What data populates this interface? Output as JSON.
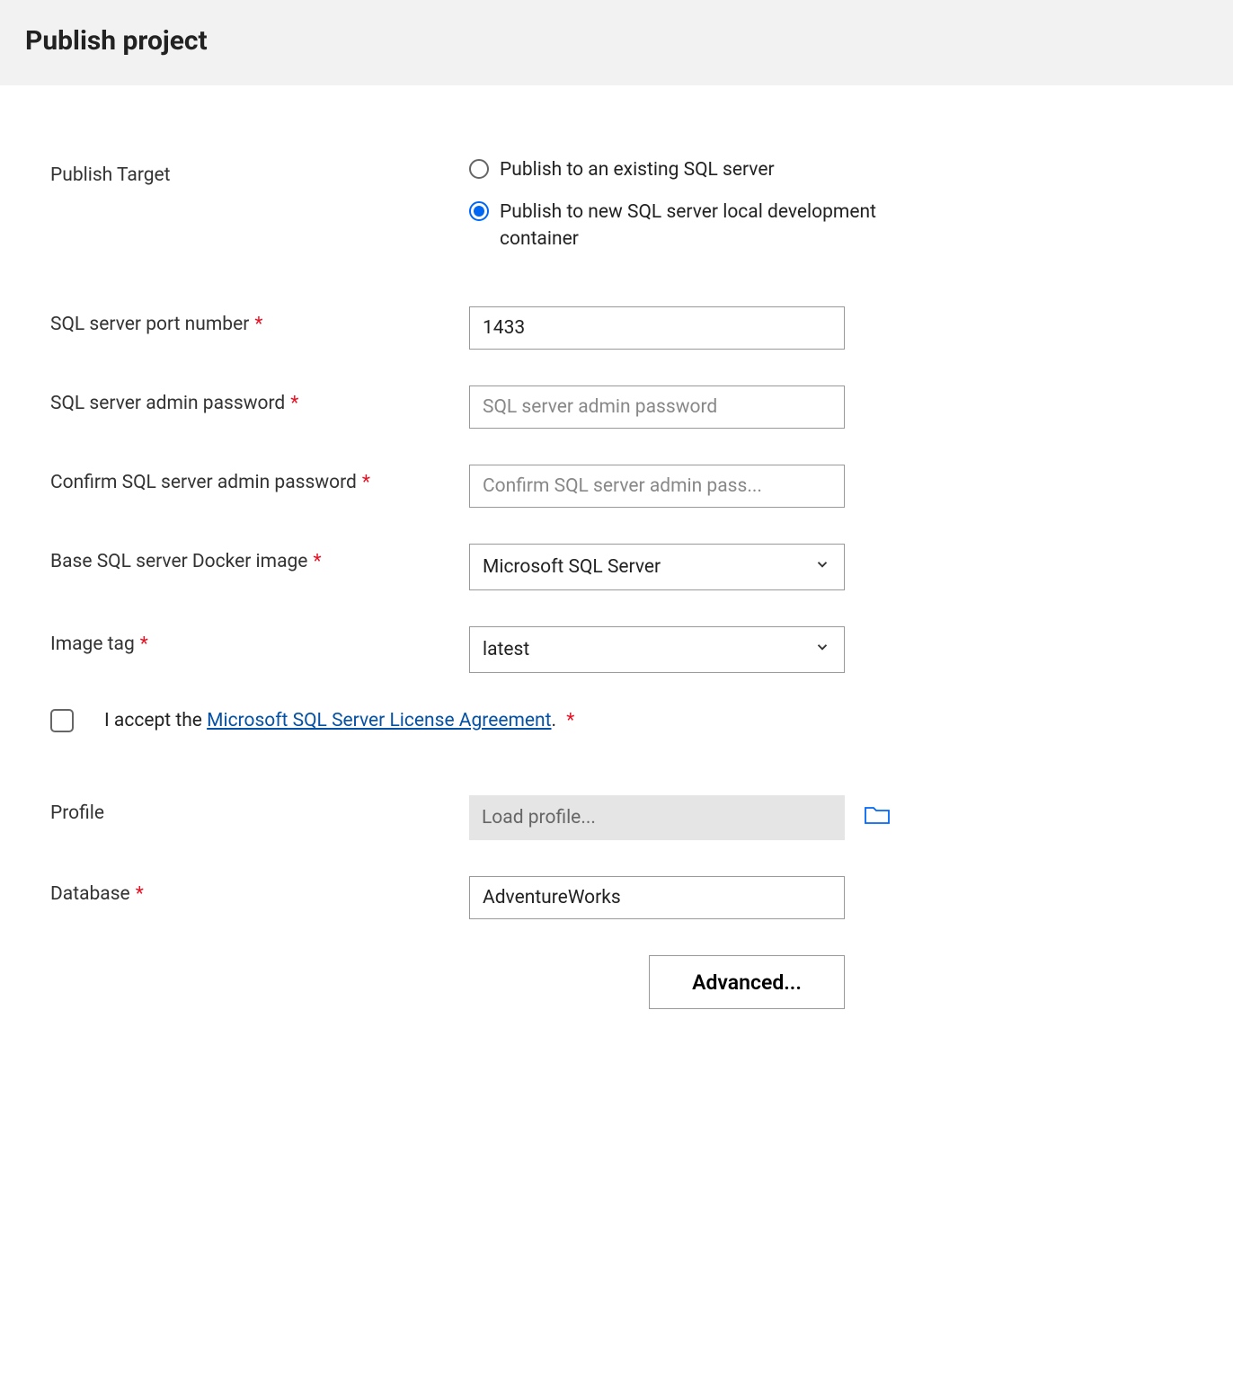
{
  "header": {
    "title": "Publish project"
  },
  "form": {
    "publishTarget": {
      "label": "Publish Target",
      "options": {
        "existing": "Publish to an existing SQL server",
        "newContainer": "Publish to new SQL server local development container"
      },
      "selected": "newContainer"
    },
    "port": {
      "label": "SQL server port number",
      "value": "1433"
    },
    "adminPassword": {
      "label": "SQL server admin password",
      "placeholder": "SQL server admin password"
    },
    "confirmPassword": {
      "label": "Confirm SQL server admin password",
      "placeholder": "Confirm SQL server admin pass..."
    },
    "dockerImage": {
      "label": "Base SQL server Docker image",
      "value": "Microsoft SQL Server"
    },
    "imageTag": {
      "label": "Image tag",
      "value": "latest"
    },
    "license": {
      "prefix": "I accept the ",
      "linkText": "Microsoft SQL Server License Agreement",
      "suffix": "."
    },
    "profile": {
      "label": "Profile",
      "placeholder": "Load profile..."
    },
    "database": {
      "label": "Database",
      "value": "AdventureWorks"
    },
    "advancedButton": "Advanced..."
  }
}
